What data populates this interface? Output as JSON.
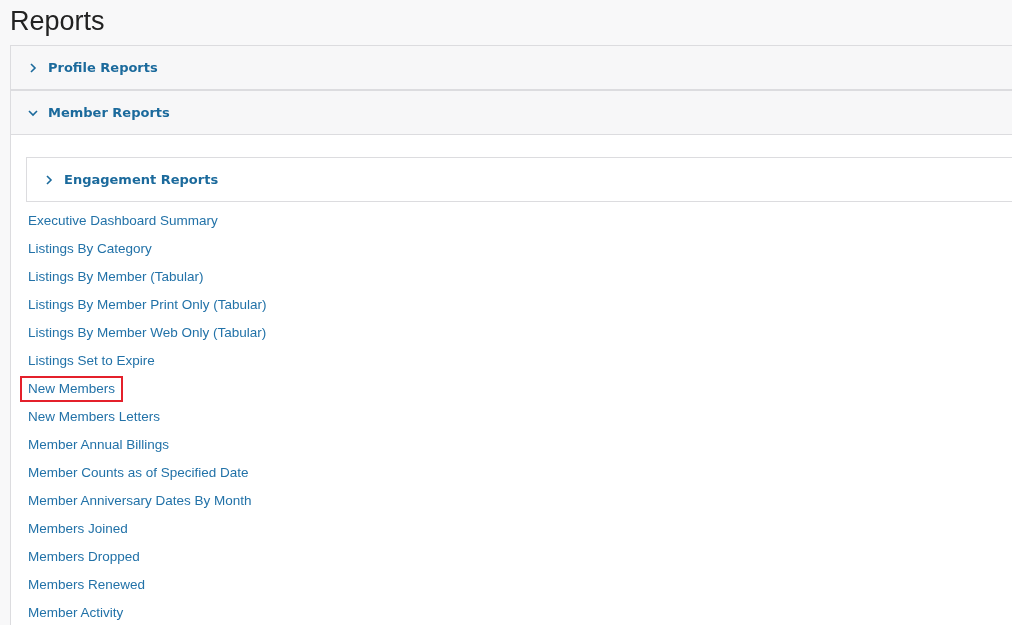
{
  "title": "Reports",
  "sections": [
    {
      "label": "Profile Reports",
      "expanded": false
    },
    {
      "label": "Member Reports",
      "expanded": true,
      "subsections": [
        {
          "label": "Engagement Reports",
          "expanded": false
        }
      ],
      "links": [
        {
          "label": "Executive Dashboard Summary",
          "highlighted": false
        },
        {
          "label": "Listings By Category",
          "highlighted": false
        },
        {
          "label": "Listings By Member (Tabular)",
          "highlighted": false
        },
        {
          "label": "Listings By Member Print Only (Tabular)",
          "highlighted": false
        },
        {
          "label": "Listings By Member Web Only (Tabular)",
          "highlighted": false
        },
        {
          "label": "Listings Set to Expire",
          "highlighted": false
        },
        {
          "label": "New Members",
          "highlighted": true
        },
        {
          "label": "New Members Letters",
          "highlighted": false
        },
        {
          "label": "Member Annual Billings",
          "highlighted": false
        },
        {
          "label": "Member Counts as of Specified Date",
          "highlighted": false
        },
        {
          "label": "Member Anniversary Dates By Month",
          "highlighted": false
        },
        {
          "label": "Members Joined",
          "highlighted": false
        },
        {
          "label": "Members Dropped",
          "highlighted": false
        },
        {
          "label": "Members Renewed",
          "highlighted": false
        },
        {
          "label": "Member Activity",
          "highlighted": false
        }
      ]
    }
  ]
}
